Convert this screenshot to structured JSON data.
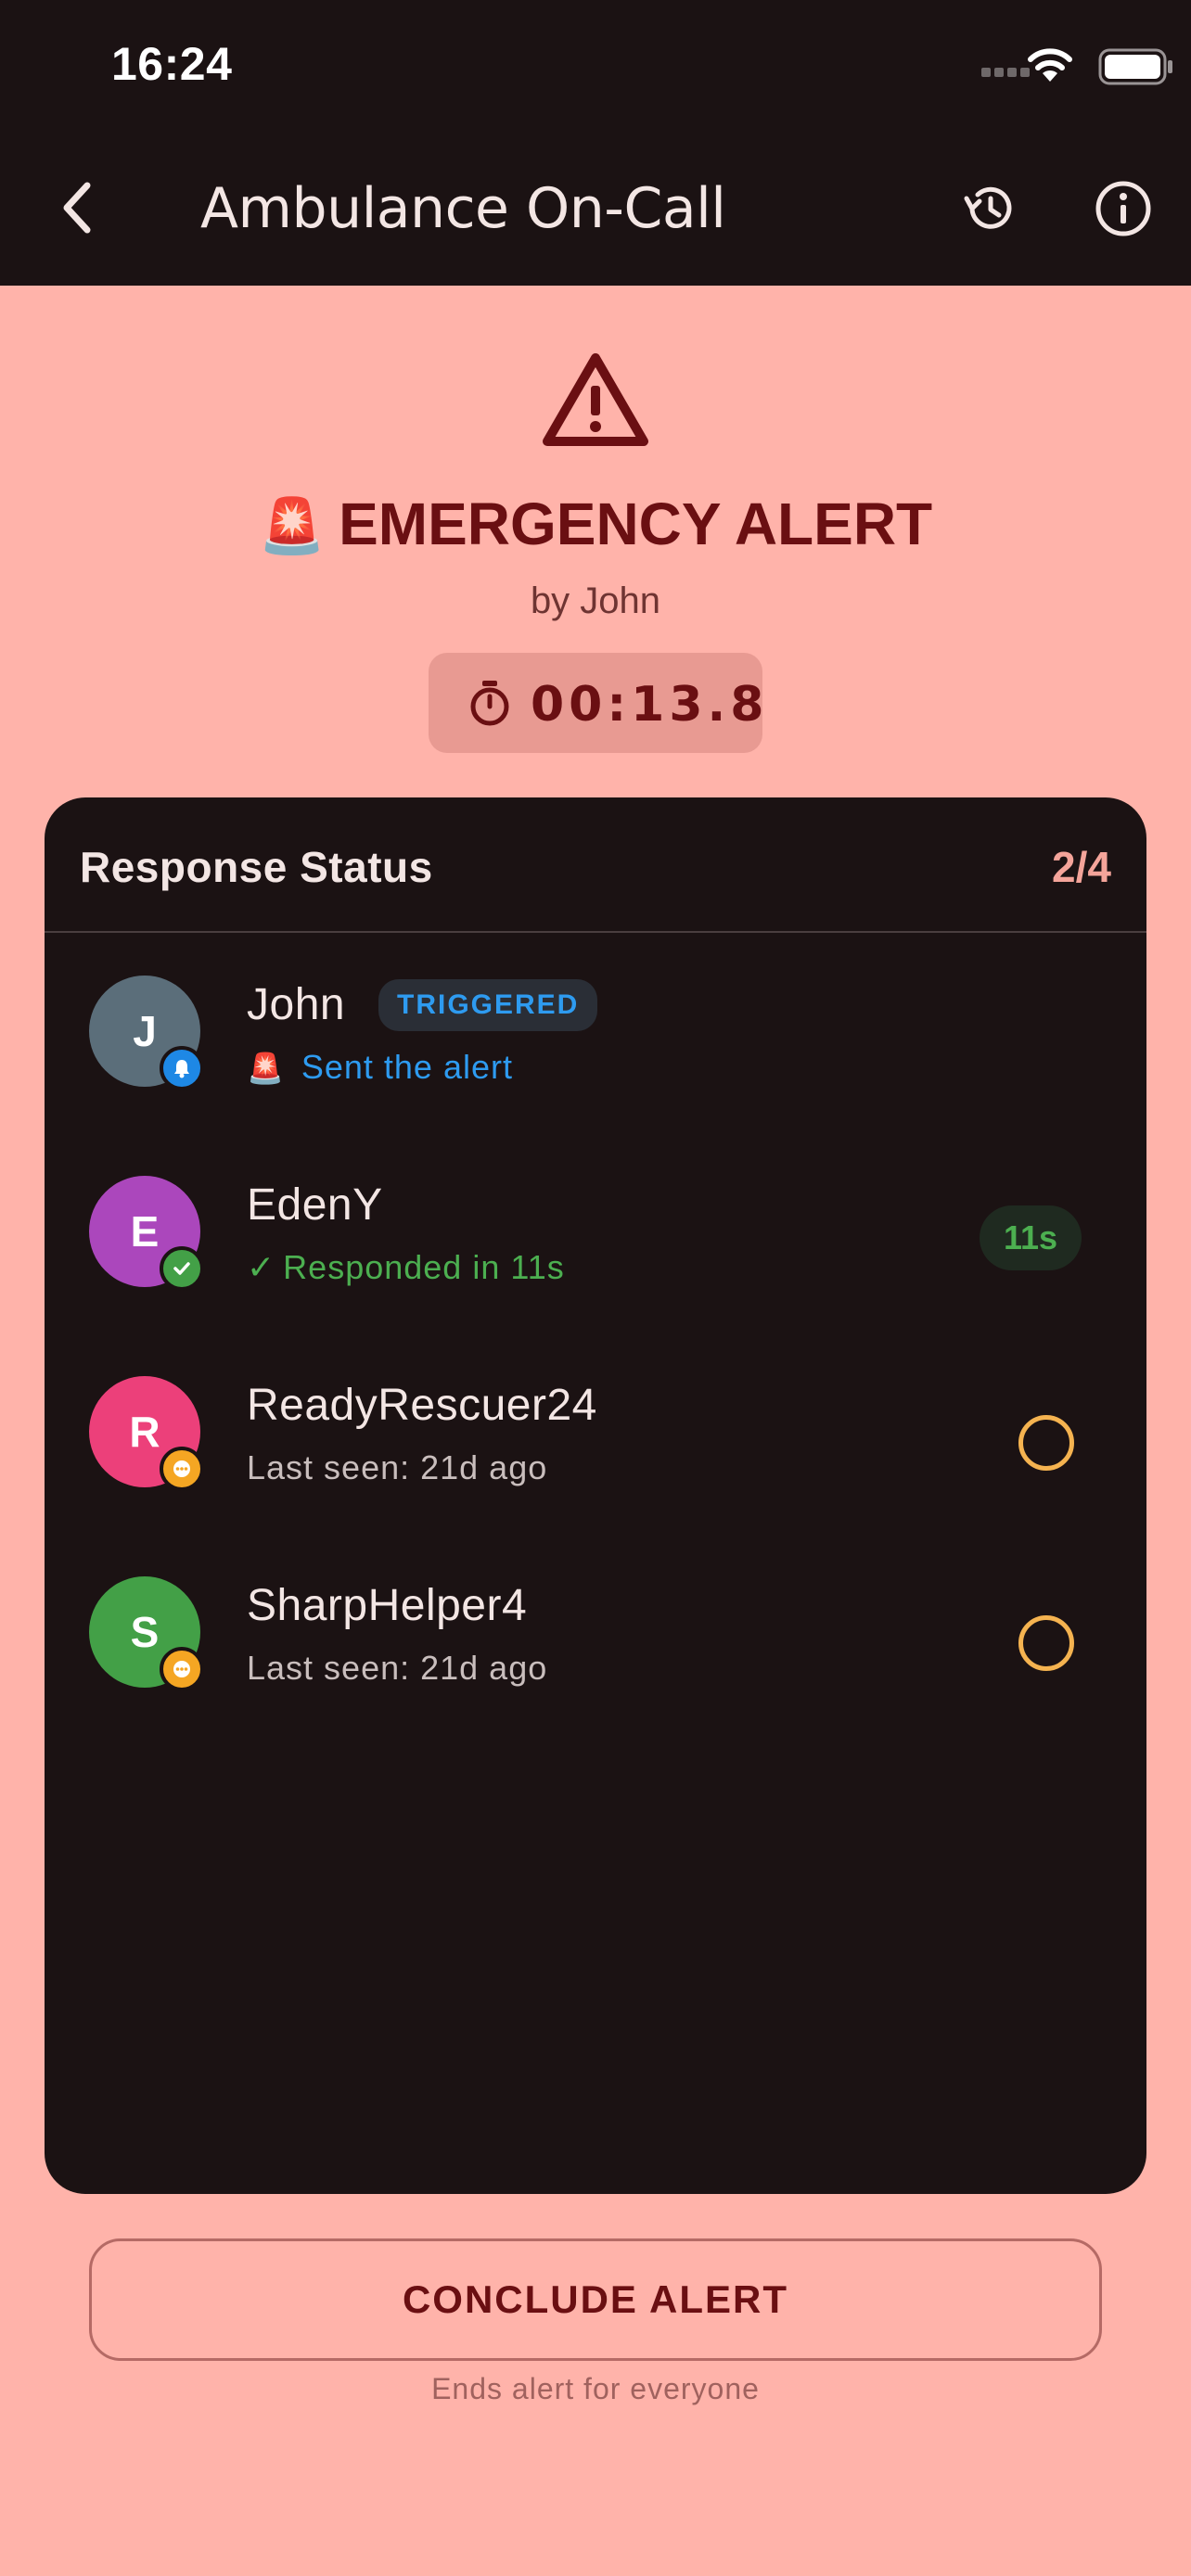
{
  "status_bar": {
    "time": "16:24"
  },
  "nav": {
    "title": "Ambulance On-Call"
  },
  "alert": {
    "siren_emoji": "🚨",
    "title": "EMERGENCY ALERT",
    "by": "by John",
    "timer": "00:13.8"
  },
  "response": {
    "title": "Response Status",
    "count": "2/4",
    "members": [
      {
        "initial": "J",
        "name": "John",
        "tag": "TRIGGERED",
        "sub_emoji": "🚨",
        "sub": "Sent the alert",
        "avatar_color": "#5B6E7A",
        "badge": "bell-icon"
      },
      {
        "initial": "E",
        "name": "EdenY",
        "sub_check": "✓",
        "sub": "Responded in 11s",
        "time": "11s",
        "avatar_color": "#AB47BC",
        "badge": "check-icon"
      },
      {
        "initial": "R",
        "name": "ReadyRescuer24",
        "sub": "Last seen: 21d ago",
        "avatar_color": "#EC407A",
        "badge": "pending-icon"
      },
      {
        "initial": "S",
        "name": "SharpHelper4",
        "sub": "Last seen: 21d ago",
        "avatar_color": "#43A047",
        "badge": "pending-icon"
      }
    ]
  },
  "footer": {
    "conclude_label": "CONCLUDE ALERT",
    "hint": "Ends alert for everyone"
  },
  "colors": {
    "background": "#FFB3AA",
    "dark": "#1B1213",
    "alert_red": "#6A0F12",
    "accent_blue": "#2E9BF0",
    "accent_green": "#4CAF50",
    "pending_orange": "#F5B350"
  }
}
